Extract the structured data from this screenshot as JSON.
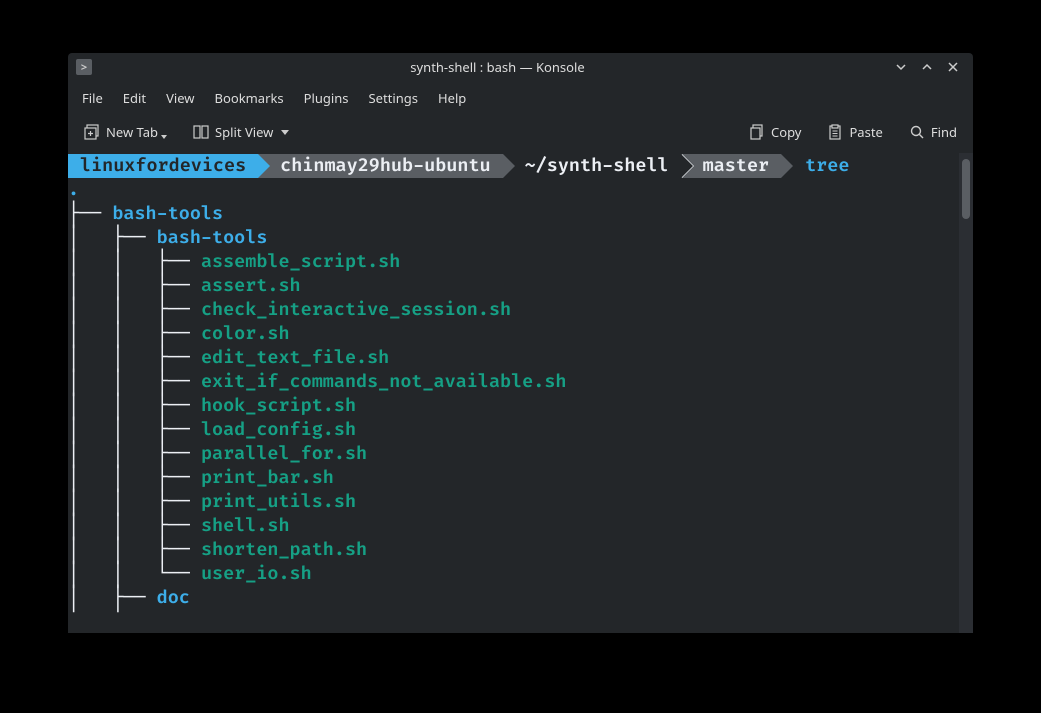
{
  "window": {
    "title": "synth-shell : bash — Konsole"
  },
  "menubar": [
    "File",
    "Edit",
    "View",
    "Bookmarks",
    "Plugins",
    "Settings",
    "Help"
  ],
  "toolbar": {
    "new_tab": "New Tab",
    "split_view": "Split View",
    "copy": "Copy",
    "paste": "Paste",
    "find": "Find"
  },
  "prompt": {
    "user": "linuxfordevices",
    "host": "chinmay29hub-ubuntu",
    "path": "~/synth-shell",
    "branch": "master",
    "command": "tree"
  },
  "tree": {
    "root": ".",
    "lines": [
      {
        "prefix": "├── ",
        "name": "bash-tools",
        "type": "dir"
      },
      {
        "prefix": "│   ├── ",
        "name": "bash-tools",
        "type": "dir"
      },
      {
        "prefix": "│   │   ├── ",
        "name": "assemble_script.sh",
        "type": "file"
      },
      {
        "prefix": "│   │   ├── ",
        "name": "assert.sh",
        "type": "file"
      },
      {
        "prefix": "│   │   ├── ",
        "name": "check_interactive_session.sh",
        "type": "file"
      },
      {
        "prefix": "│   │   ├── ",
        "name": "color.sh",
        "type": "file"
      },
      {
        "prefix": "│   │   ├── ",
        "name": "edit_text_file.sh",
        "type": "file"
      },
      {
        "prefix": "│   │   ├── ",
        "name": "exit_if_commands_not_available.sh",
        "type": "file"
      },
      {
        "prefix": "│   │   ├── ",
        "name": "hook_script.sh",
        "type": "file"
      },
      {
        "prefix": "│   │   ├── ",
        "name": "load_config.sh",
        "type": "file"
      },
      {
        "prefix": "│   │   ├── ",
        "name": "parallel_for.sh",
        "type": "file"
      },
      {
        "prefix": "│   │   ├── ",
        "name": "print_bar.sh",
        "type": "file"
      },
      {
        "prefix": "│   │   ├── ",
        "name": "print_utils.sh",
        "type": "file"
      },
      {
        "prefix": "│   │   ├── ",
        "name": "shell.sh",
        "type": "file"
      },
      {
        "prefix": "│   │   ├── ",
        "name": "shorten_path.sh",
        "type": "file"
      },
      {
        "prefix": "│   │   └── ",
        "name": "user_io.sh",
        "type": "file"
      },
      {
        "prefix": "│   ├── ",
        "name": "doc",
        "type": "dir"
      }
    ]
  }
}
